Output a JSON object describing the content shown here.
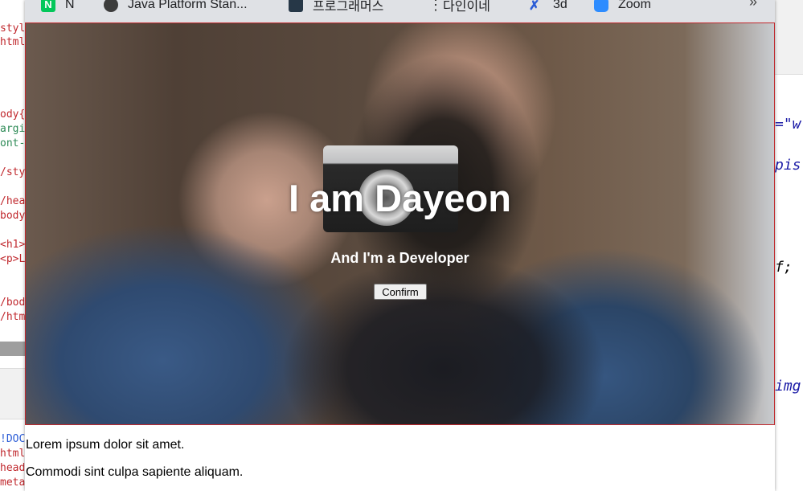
{
  "editor_left": {
    "lines": [
      {
        "text": "styl",
        "color": "#c0282d"
      },
      {
        "text": "html{",
        "color": "#c0282d"
      },
      {
        "text": "ody{",
        "color": "#c0282d"
      },
      {
        "text": "argi",
        "color": "#2e8b57"
      },
      {
        "text": "ont-",
        "color": "#2e8b57"
      },
      {
        "text": "/sty",
        "color": "#c0282d"
      },
      {
        "text": "/hea",
        "color": "#c0282d"
      },
      {
        "text": "body",
        "color": "#c0282d"
      },
      {
        "text": "<h1>",
        "color": "#c0282d"
      },
      {
        "text": "<p>L",
        "color": "#c0282d"
      },
      {
        "text": "/bod",
        "color": "#c0282d"
      },
      {
        "text": "/htm",
        "color": "#c0282d"
      },
      {
        "text": "!DOC",
        "color": "#2b5cd6"
      },
      {
        "text": "html",
        "color": "#c0282d"
      },
      {
        "text": "head",
        "color": "#c0282d"
      },
      {
        "text": "meta",
        "color": "#c0282d"
      }
    ]
  },
  "editor_right": {
    "lines": [
      {
        "text": "=\"w",
        "color": "#1a1aa6"
      },
      {
        "text": "pis.",
        "color": "#1a1aa6"
      },
      {
        "text": "f;",
        "color": "#000000"
      },
      {
        "text": "img",
        "color": "#1a1aa6"
      }
    ]
  },
  "bookmarks": [
    {
      "label": "N",
      "icon": "naver-icon"
    },
    {
      "label": "Java Platform Stan...",
      "icon": "java-icon"
    },
    {
      "label": "프로그래머스",
      "icon": "programmers-icon"
    },
    {
      "label": "다인이네",
      "icon": "dots-icon"
    },
    {
      "label": "3d",
      "icon": "3d-icon"
    },
    {
      "label": "Zoom",
      "icon": "zoom-icon"
    }
  ],
  "bookmarks_more": "»",
  "hero": {
    "title": "I am Dayeon",
    "subtitle": "And I'm a Developer",
    "button_label": "Confirm"
  },
  "paragraphs": [
    "Lorem ipsum dolor sit amet.",
    "Commodi sint culpa sapiente aliquam."
  ]
}
